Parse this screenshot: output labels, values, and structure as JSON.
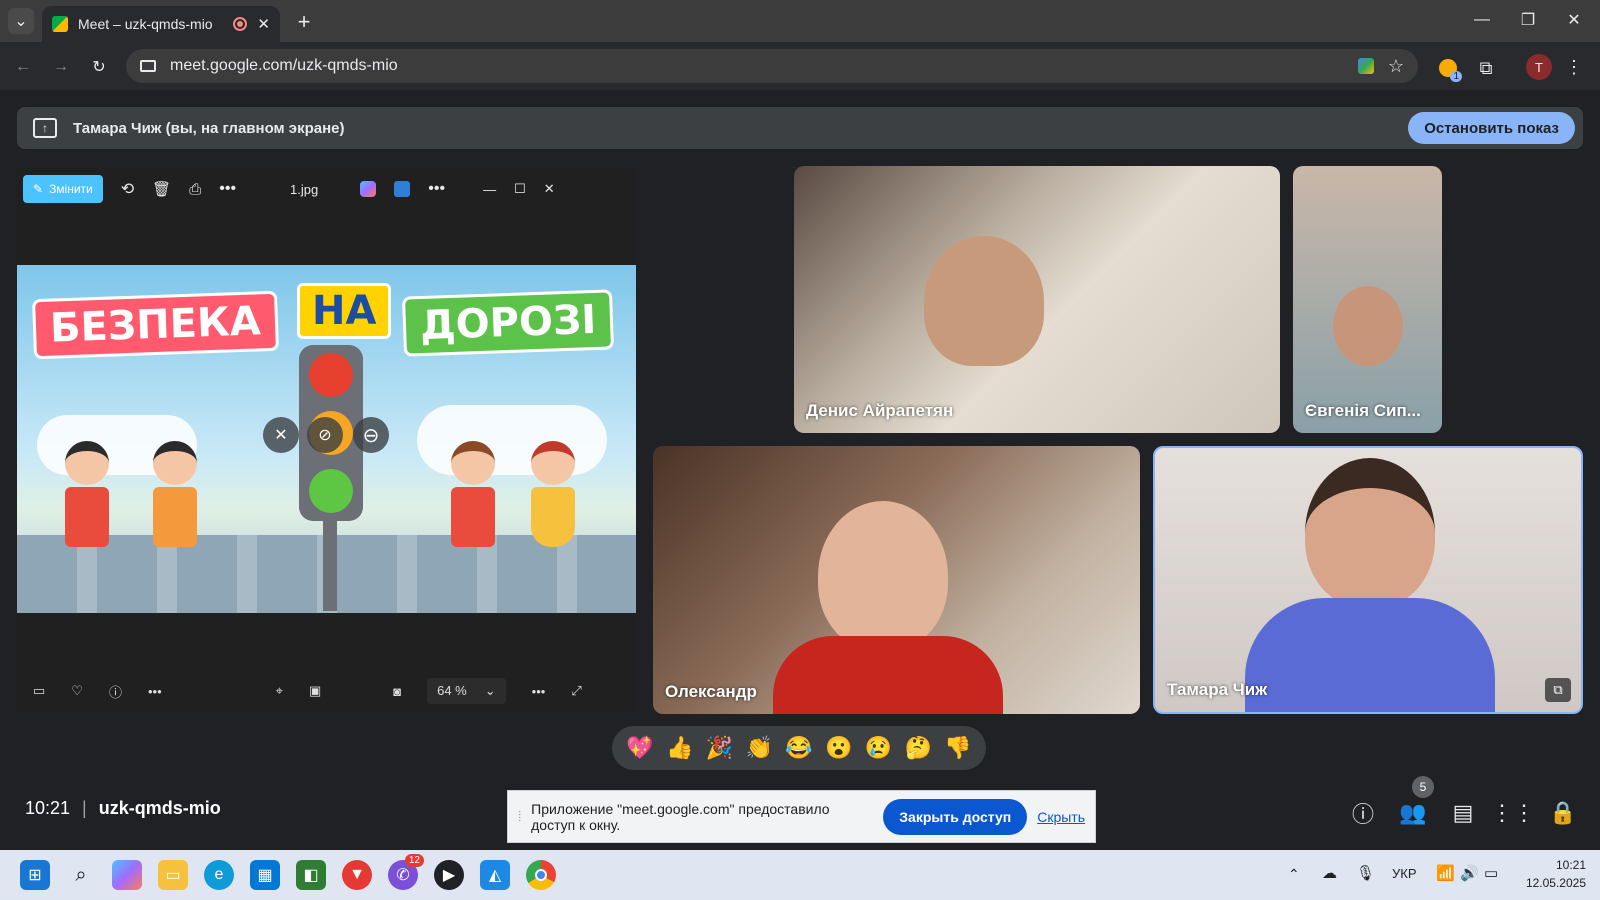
{
  "browser": {
    "tab_title": "Meet – uzk-qmds-mio",
    "url": "meet.google.com/uzk-qmds-mio",
    "profile_initial": "T",
    "extension_badge": "1"
  },
  "share_banner": {
    "text": "Тамара Чиж (вы, на главном экране)",
    "stop_label": "Остановить показ"
  },
  "photos_app": {
    "edit_label": "Змінити",
    "file_name": "1.jpg",
    "zoom": "64 %",
    "slide": {
      "word1": "БЕЗПЕКА",
      "word2": "НА",
      "word3": "ДОРОЗІ"
    }
  },
  "participants": [
    {
      "name": "Денис Айрапетян"
    },
    {
      "name": "Євгенія Сип..."
    },
    {
      "name": "Олександр"
    },
    {
      "name": "Тамара Чиж"
    }
  ],
  "reactions": [
    "💖",
    "👍",
    "🎉",
    "👏",
    "😂",
    "😮",
    "😢",
    "🤔",
    "👎"
  ],
  "meeting": {
    "time": "10:21",
    "code": "uzk-qmds-mio",
    "people_count": "5"
  },
  "notice": {
    "text": "Приложение \"meet.google.com\" предоставило доступ к окну.",
    "close_label": "Закрыть доступ",
    "hide_label": "Скрыть"
  },
  "taskbar": {
    "viber_badge": "12",
    "lang": "УКР",
    "time": "10:21",
    "date": "12.05.2025"
  },
  "colors": {
    "meet_bg": "#202124",
    "accent_blue": "#8ab4f8",
    "photos_accent": "#4cc2ff",
    "notice_button": "#0b57d0"
  }
}
